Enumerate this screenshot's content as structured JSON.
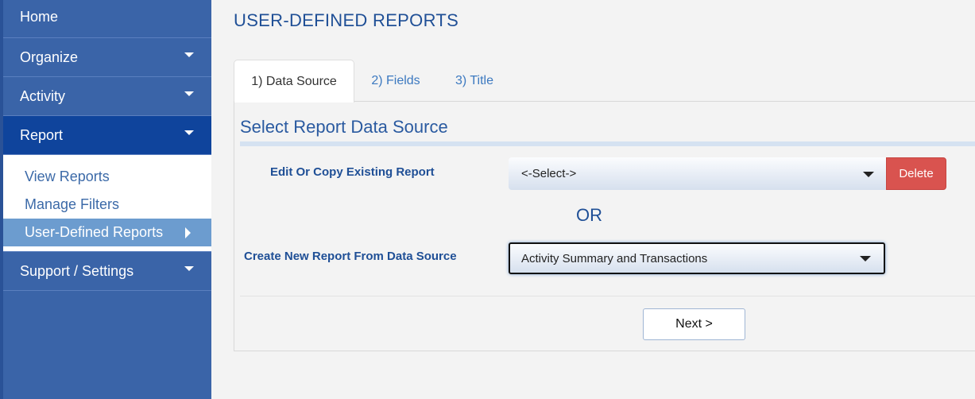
{
  "sidebar": {
    "home": "Home",
    "organize": "Organize",
    "activity": "Activity",
    "report": "Report",
    "report_submenu": [
      "View Reports",
      "Manage Filters",
      "User-Defined Reports"
    ],
    "support": "Support / Settings"
  },
  "page": {
    "title": "USER-DEFINED REPORTS"
  },
  "tabs": [
    "1) Data Source",
    "2) Fields",
    "3) Title"
  ],
  "form": {
    "section_title": "Select Report Data Source",
    "edit_label": "Edit Or Copy Existing Report",
    "edit_selected": "<-Select->",
    "delete_label": "Delete",
    "or_text": "OR",
    "create_label": "Create New Report From Data Source",
    "create_selected": "Activity Summary and Transactions",
    "next_label": "Next >"
  },
  "colors": {
    "sidebar_bg": "#3a64a8",
    "sidebar_active": "#0f449c",
    "submenu_selected": "#6c9ccf",
    "accent_text": "#1f4f96",
    "delete_button": "#d9534f"
  }
}
